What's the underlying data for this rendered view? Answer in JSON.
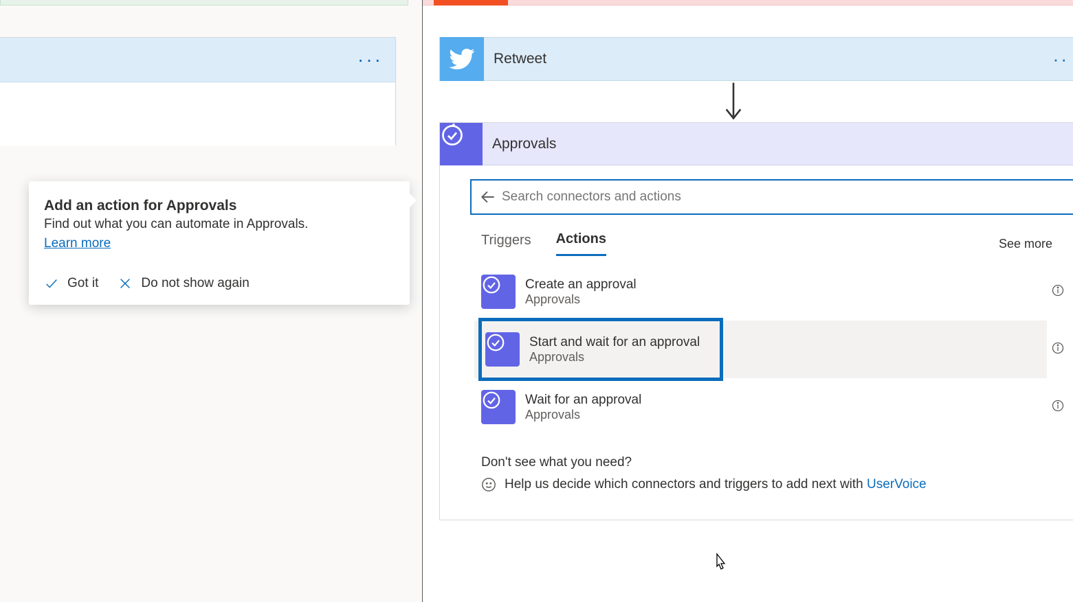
{
  "callout": {
    "title": "Add an action for Approvals",
    "subtitle": "Find out what you can automate in Approvals.",
    "learn_more": "Learn more",
    "got_it": "Got it",
    "do_not_show": "Do not show again"
  },
  "flow": {
    "retweet_label": "Retweet",
    "approvals_label": "Approvals"
  },
  "search": {
    "placeholder": "Search connectors and actions",
    "value": ""
  },
  "tabs": {
    "triggers": "Triggers",
    "actions": "Actions",
    "see_more": "See more"
  },
  "actions": [
    {
      "title": "Create an approval",
      "subtitle": "Approvals"
    },
    {
      "title": "Start and wait for an approval",
      "subtitle": "Approvals"
    },
    {
      "title": "Wait for an approval",
      "subtitle": "Approvals"
    }
  ],
  "footer": {
    "dont_see_title": "Don't see what you need?",
    "help_prefix": "Help us decide which connectors and triggers to add next with ",
    "uservoice": "UserVoice"
  }
}
